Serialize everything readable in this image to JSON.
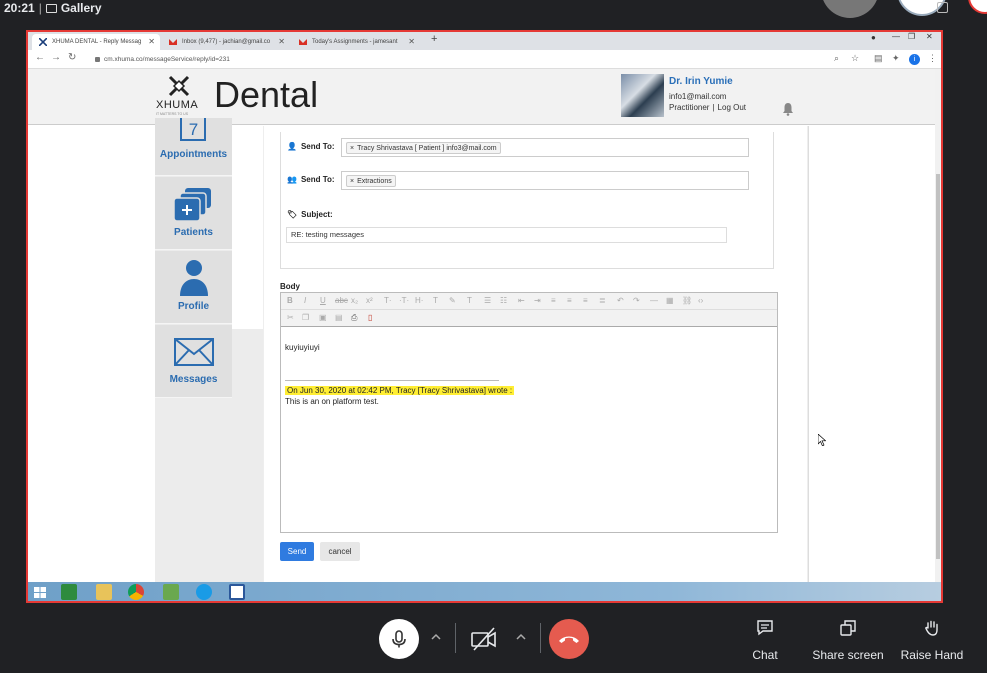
{
  "meeting": {
    "time": "20:21",
    "view_label": "Gallery",
    "controls": {
      "chat": "Chat",
      "share_screen": "Share screen",
      "raise_hand": "Raise Hand"
    }
  },
  "browser": {
    "tabs": [
      {
        "title": "XHUMA DENTAL - Reply Messag",
        "active": true
      },
      {
        "title": "Inbox (9,477) - jachian@gmail.co",
        "active": false
      },
      {
        "title": "Today's Assignments - jamesant",
        "active": false
      }
    ],
    "url": "cm.xhuma.co/messageService/reply/id=231",
    "profile_initial": "i"
  },
  "site": {
    "logo_brand": "XHUMA",
    "logo_tagline": "IT MATTERS TO US",
    "product": "Dental",
    "user": {
      "name": "Dr. Irin Yumie",
      "email": "info1@mail.com",
      "role": "Practitioner",
      "logout": "Log Out"
    }
  },
  "sidebar": {
    "items": [
      {
        "label": "Appointments",
        "icon": "calendar-icon",
        "badge": "7"
      },
      {
        "label": "Patients",
        "icon": "folders-icon"
      },
      {
        "label": "Profile",
        "icon": "person-icon"
      },
      {
        "label": "Messages",
        "icon": "envelope-icon"
      }
    ]
  },
  "form": {
    "send_to_label": "Send To:",
    "send_to_person": "Tracy Shrivastava [ Patient ] info3@mail.com",
    "send_to_group_label": "Send To:",
    "send_to_group": "Extractions",
    "subject_label": "Subject:",
    "subject_value": "RE: testing messages",
    "body_label": "Body",
    "body_text": "kuyiuyiuyi",
    "quote_header": "On Jun 30, 2020 at 02:42 PM, Tracy [Tracy Shrivastava] wrote :",
    "quote_text": "This is an on platform test.",
    "send_button": "Send",
    "cancel_button": "cancel"
  },
  "colors": {
    "accent": "#2f7be0",
    "link": "#2b6cb0",
    "share_border": "#e53935",
    "end_call": "#e55b4f",
    "highlight": "#ffee33"
  }
}
